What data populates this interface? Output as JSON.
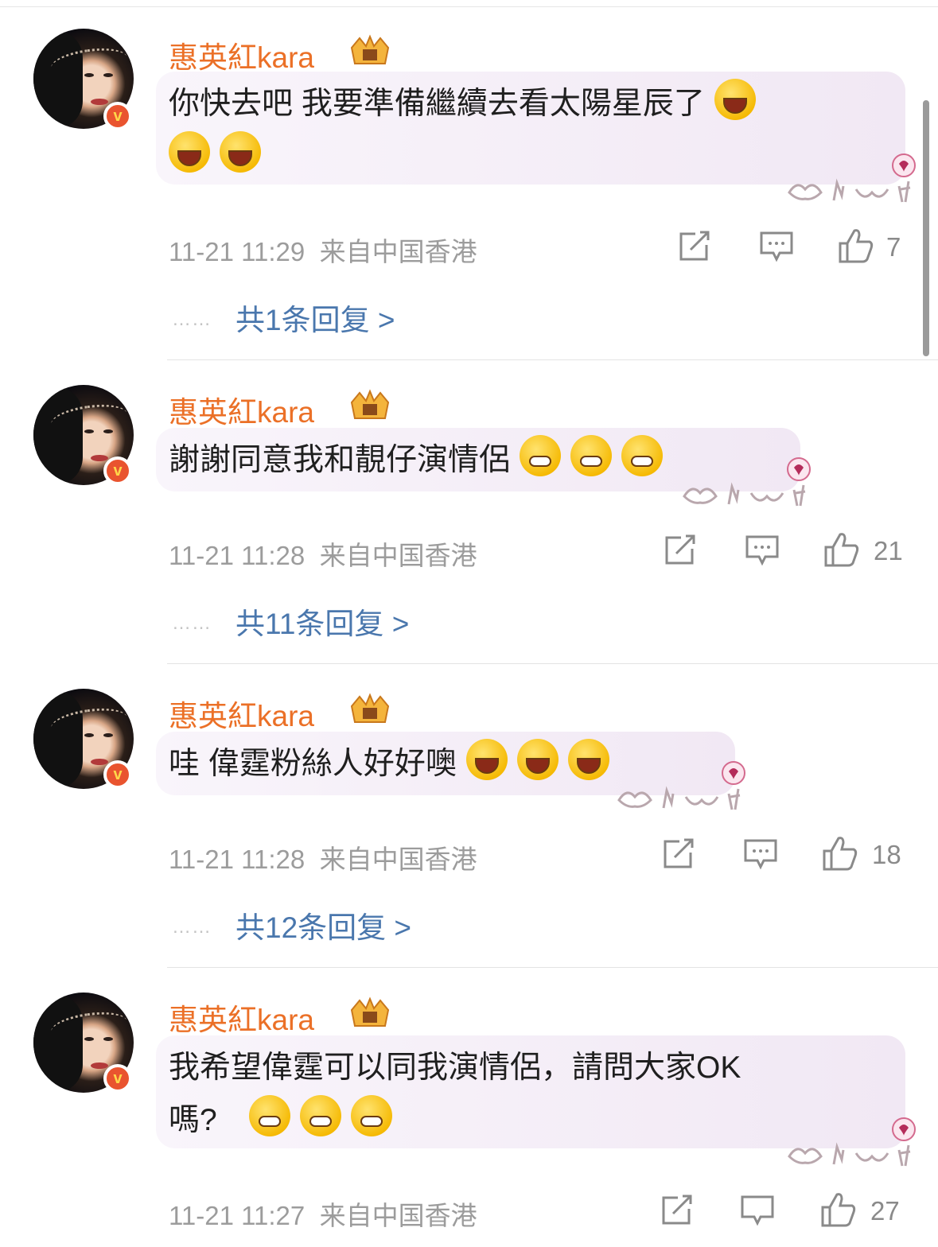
{
  "comments": [
    {
      "author": "惠英紅kara",
      "lines": [
        "你快去吧 我要準備繼續去看太陽星辰了",
        ""
      ],
      "timestamp": "11-21 11:29",
      "location": "来自中国香港",
      "likes": "7",
      "replies": "共1条回复 >"
    },
    {
      "author": "惠英紅kara",
      "lines": [
        "謝謝同意我和靚仔演情侶"
      ],
      "timestamp": "11-21 11:28",
      "location": "来自中国香港",
      "likes": "21",
      "replies": "共11条回复 >"
    },
    {
      "author": "惠英紅kara",
      "lines": [
        "哇 偉霆粉絲人好好噢"
      ],
      "timestamp": "11-21 11:28",
      "location": "来自中国香港",
      "likes": "18",
      "replies": "共12条回复 >"
    },
    {
      "author": "惠英紅kara",
      "lines": [
        "我希望偉霆可以同我演情侶，請問大家OK",
        "嗎?"
      ],
      "timestamp": "11-21 11:27",
      "location": "来自中国香港",
      "likes": "27"
    }
  ],
  "icons": {
    "verified": "v-badge",
    "crown": "crown-icon",
    "repost": "repost-icon",
    "comment": "comment-icon",
    "like": "thumbs-up-icon"
  },
  "badge_text": "v",
  "reply_dots": "……",
  "colors": {
    "author": "#eb7027",
    "reply_link": "#4a77ad",
    "meta": "#9c9c9c",
    "badge": "#e9542f"
  }
}
